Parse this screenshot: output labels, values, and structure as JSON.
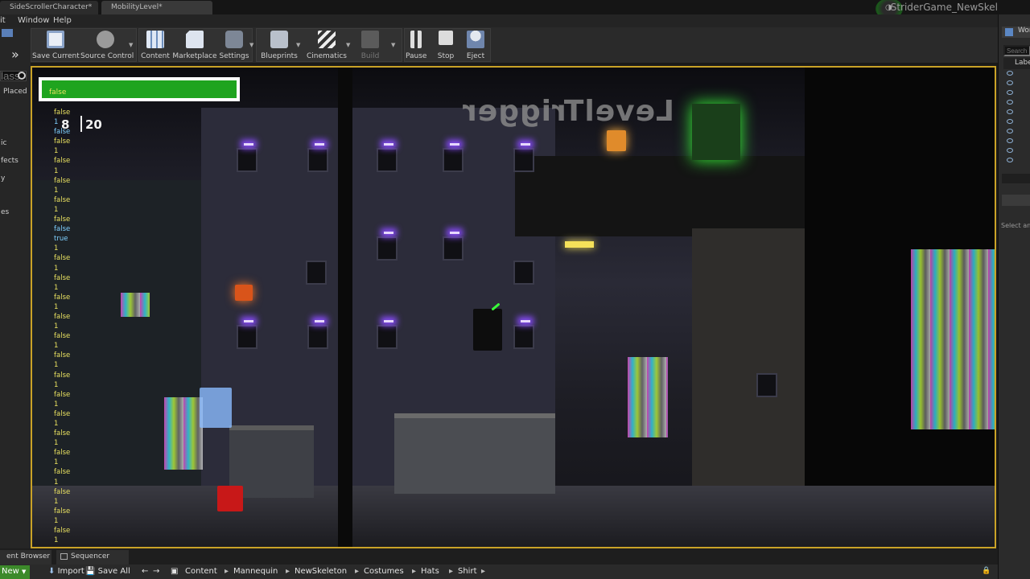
{
  "tabs": [
    {
      "label": "SideScrollerCharacter*"
    },
    {
      "label": "MobilityLevel*"
    }
  ],
  "window_title": "StriderGame_NewSkel",
  "menu": [
    "it",
    "Window",
    "Help"
  ],
  "left_strip": {
    "search_placeholder": "lass",
    "labels": [
      "Placed",
      "ic",
      "fects",
      "y",
      "es"
    ]
  },
  "toolbar": {
    "buttons": [
      {
        "label": "Save Current",
        "icon": "save-icon"
      },
      {
        "label": "Source Control",
        "icon": "source-control-icon"
      },
      {
        "label": "Content",
        "icon": "content-icon"
      },
      {
        "label": "Marketplace",
        "icon": "marketplace-icon"
      },
      {
        "label": "Settings",
        "icon": "settings-icon"
      },
      {
        "label": "Blueprints",
        "icon": "blueprints-icon"
      },
      {
        "label": "Cinematics",
        "icon": "cinematics-icon"
      },
      {
        "label": "Build",
        "icon": "build-icon"
      },
      {
        "label": "Pause",
        "icon": "pause-icon"
      },
      {
        "label": "Stop",
        "icon": "stop-icon"
      },
      {
        "label": "Eject",
        "icon": "eject-icon"
      }
    ]
  },
  "viewport": {
    "trigger_text": "LevelTrigger",
    "hud": {
      "health_label": "false",
      "health_fraction": 1.0,
      "count_a": "8",
      "count_b": "20"
    },
    "debug_log": [
      {
        "text": "false",
        "color": "#e8e060"
      },
      {
        "text": "1",
        "color": "#7fd0ff"
      },
      {
        "text": "false",
        "color": "#7fd0ff"
      },
      {
        "text": "false",
        "color": "#e8e060"
      },
      {
        "text": "1",
        "color": "#e8e060"
      },
      {
        "text": "false",
        "color": "#e8e060"
      },
      {
        "text": "1",
        "color": "#e8e060"
      },
      {
        "text": "false",
        "color": "#e8e060"
      },
      {
        "text": "1",
        "color": "#e8e060"
      },
      {
        "text": "false",
        "color": "#e8e060"
      },
      {
        "text": "1",
        "color": "#e8e060"
      },
      {
        "text": "false",
        "color": "#e8e060"
      },
      {
        "text": "false",
        "color": "#7fd0ff"
      },
      {
        "text": "true",
        "color": "#7fd0ff"
      },
      {
        "text": "1",
        "color": "#e8e060"
      },
      {
        "text": "false",
        "color": "#e8e060"
      },
      {
        "text": "1",
        "color": "#e8e060"
      },
      {
        "text": "false",
        "color": "#e8e060"
      },
      {
        "text": "1",
        "color": "#e8e060"
      },
      {
        "text": "false",
        "color": "#e8e060"
      },
      {
        "text": "1",
        "color": "#e8e060"
      },
      {
        "text": "false",
        "color": "#e8e060"
      },
      {
        "text": "1",
        "color": "#e8e060"
      },
      {
        "text": "false",
        "color": "#e8e060"
      },
      {
        "text": "1",
        "color": "#e8e060"
      },
      {
        "text": "false",
        "color": "#e8e060"
      },
      {
        "text": "1",
        "color": "#e8e060"
      },
      {
        "text": "false",
        "color": "#e8e060"
      },
      {
        "text": "1",
        "color": "#e8e060"
      },
      {
        "text": "false",
        "color": "#e8e060"
      },
      {
        "text": "1",
        "color": "#e8e060"
      },
      {
        "text": "false",
        "color": "#e8e060"
      },
      {
        "text": "1",
        "color": "#e8e060"
      },
      {
        "text": "false",
        "color": "#e8e060"
      },
      {
        "text": "1",
        "color": "#e8e060"
      },
      {
        "text": "false",
        "color": "#e8e060"
      },
      {
        "text": "1",
        "color": "#e8e060"
      },
      {
        "text": "false",
        "color": "#e8e060"
      },
      {
        "text": "1",
        "color": "#e8e060"
      },
      {
        "text": "false",
        "color": "#e8e060"
      },
      {
        "text": "1",
        "color": "#e8e060"
      },
      {
        "text": "false",
        "color": "#e8e060"
      },
      {
        "text": "1",
        "color": "#e8e060"
      },
      {
        "text": "false",
        "color": "#e8e060"
      },
      {
        "text": "1",
        "color": "#e8e060"
      }
    ]
  },
  "right_panel": {
    "tab_label": "Wor",
    "search_placeholder": "Search",
    "column_label": "Labe",
    "details_hint": "Select an"
  },
  "bottom_tabs": [
    {
      "label": "ent Browser"
    },
    {
      "label": "Sequencer"
    }
  ],
  "content_bar": {
    "new_label": "New",
    "import_label": "Import",
    "save_all_label": "Save All",
    "breadcrumb": [
      "Content",
      "Mannequin",
      "NewSkeleton",
      "Costumes",
      "Hats",
      "Shirt"
    ]
  },
  "colors": {
    "viewport_border": "#c9a227",
    "health_fill": "#1fa41f",
    "accent_green": "#3c8a2a"
  }
}
